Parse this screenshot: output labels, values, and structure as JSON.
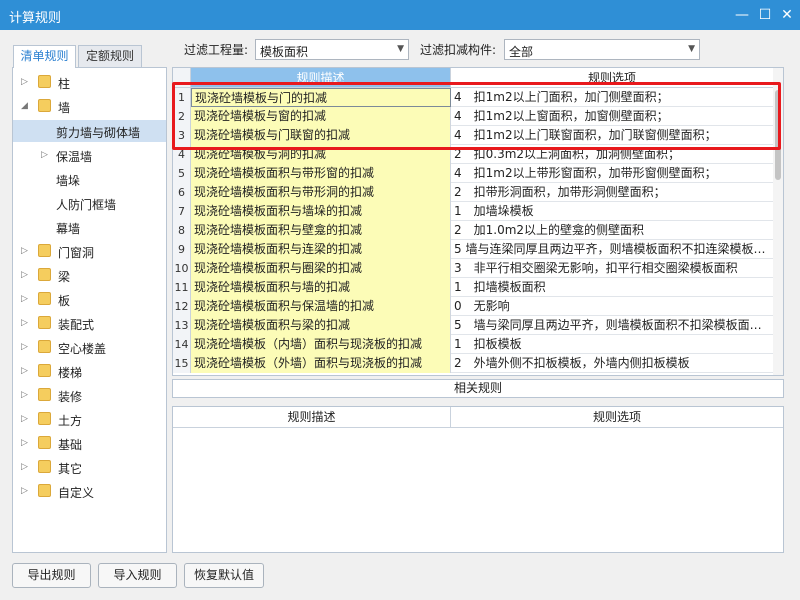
{
  "window": {
    "title": "计算规则"
  },
  "tabs": [
    {
      "label": "清单规则"
    },
    {
      "label": "定额规则"
    }
  ],
  "tree": [
    {
      "label": "柱",
      "folder": true,
      "arrow": "▷"
    },
    {
      "label": "墙",
      "folder": true,
      "arrow": "◢"
    },
    {
      "label": "剪力墙与砌体墙",
      "folder": false,
      "selected": true
    },
    {
      "label": "保温墙",
      "folder": false,
      "arrow": "▷"
    },
    {
      "label": "墙垛",
      "folder": false
    },
    {
      "label": "人防门框墙",
      "folder": false
    },
    {
      "label": "幕墙",
      "folder": false
    },
    {
      "label": "门窗洞",
      "folder": true,
      "arrow": "▷"
    },
    {
      "label": "梁",
      "folder": true,
      "arrow": "▷"
    },
    {
      "label": "板",
      "folder": true,
      "arrow": "▷"
    },
    {
      "label": "装配式",
      "folder": true,
      "arrow": "▷"
    },
    {
      "label": "空心楼盖",
      "folder": true,
      "arrow": "▷"
    },
    {
      "label": "楼梯",
      "folder": true,
      "arrow": "▷"
    },
    {
      "label": "装修",
      "folder": true,
      "arrow": "▷"
    },
    {
      "label": "土方",
      "folder": true,
      "arrow": "▷"
    },
    {
      "label": "基础",
      "folder": true,
      "arrow": "▷"
    },
    {
      "label": "其它",
      "folder": true,
      "arrow": "▷"
    },
    {
      "label": "自定义",
      "folder": true,
      "arrow": "▷"
    }
  ],
  "filters": {
    "quantity_label": "过滤工程量:",
    "quantity_value": "模板面积",
    "deduct_label": "过滤扣减构件:",
    "deduct_value": "全部"
  },
  "grid": {
    "col_desc": "规则描述",
    "col_opt": "规则选项",
    "rows": [
      {
        "n": "1",
        "desc": "现浇砼墙模板与门的扣减",
        "opt": "4　扣1m2以上门面积，加门侧壁面积；"
      },
      {
        "n": "2",
        "desc": "现浇砼墙模板与窗的扣减",
        "opt": "4　扣1m2以上窗面积，加窗侧壁面积；"
      },
      {
        "n": "3",
        "desc": "现浇砼墙模板与门联窗的扣减",
        "opt": "4　扣1m2以上门联窗面积，加门联窗侧壁面积；"
      },
      {
        "n": "4",
        "desc": "现浇砼墙模板与洞的扣减",
        "opt": "2　扣0.3m2以上洞面积，加洞侧壁面积；"
      },
      {
        "n": "5",
        "desc": "现浇砼墙模板面积与带形窗的扣减",
        "opt": "4　扣1m2以上带形窗面积，加带形窗侧壁面积；"
      },
      {
        "n": "6",
        "desc": "现浇砼墙模板面积与带形洞的扣减",
        "opt": "2　扣带形洞面积，加带形洞侧壁面积；"
      },
      {
        "n": "7",
        "desc": "现浇砼墙模板面积与墙垛的扣减",
        "opt": "1　加墙垛模板"
      },
      {
        "n": "8",
        "desc": "现浇砼墙模板面积与壁龛的扣减",
        "opt": "2　加1.0m2以上的壁龛的侧壁面积"
      },
      {
        "n": "9",
        "desc": "现浇砼墙模板面积与连梁的扣减",
        "opt": "5 墙与连梁同厚且两边平齐，则墙模板面积不扣连梁模板…"
      },
      {
        "n": "10",
        "desc": "现浇砼墙模板面积与圈梁的扣减",
        "opt": "3　非平行相交圈梁无影响，扣平行相交圈梁模板面积"
      },
      {
        "n": "11",
        "desc": "现浇砼墙模板面积与墙的扣减",
        "opt": "1　扣墙模板面积"
      },
      {
        "n": "12",
        "desc": "现浇砼墙模板面积与保温墙的扣减",
        "opt": "0　无影响"
      },
      {
        "n": "13",
        "desc": "现浇砼墙模板面积与梁的扣减",
        "opt": "5　墙与梁同厚且两边平齐，则墙模板面积不扣梁模板面…"
      },
      {
        "n": "14",
        "desc": "现浇砼墙模板（内墙）面积与现浇板的扣减",
        "opt": "1　扣板模板"
      },
      {
        "n": "15",
        "desc": "现浇砼墙模板（外墙）面积与现浇板的扣减",
        "opt": "2　外墙外侧不扣板模板，外墙内侧扣板模板"
      }
    ]
  },
  "related": {
    "title": "相关规则",
    "col_desc": "规则描述",
    "col_opt": "规则选项"
  },
  "buttons": {
    "export": "导出规则",
    "import": "导入规则",
    "restore": "恢复默认值"
  },
  "colors": {
    "titlebar": "#2f8fd6",
    "highlight_border": "#e8191d",
    "desc_cell_bg": "#fcfcb7",
    "header_bg": "#8ec1ec"
  }
}
